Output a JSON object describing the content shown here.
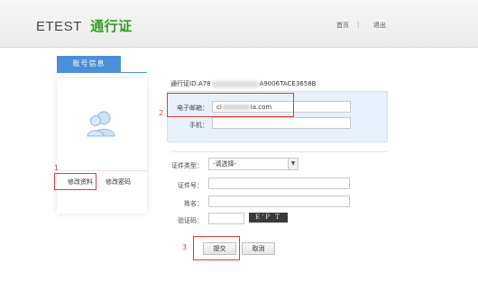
{
  "header": {
    "brand_latin": "ETEST",
    "brand_cn": "通行证",
    "nav_home": "首页",
    "nav_sep": "|",
    "nav_logout": "退出"
  },
  "left": {
    "tab_title": "账号信息",
    "avatar_icon": "user-group-icon",
    "link_edit": "修改资料",
    "link_password": "修改密码"
  },
  "form": {
    "uid_prefix": "通行证ID:A78",
    "uid_suffix": "A9006TACE3658B",
    "email_label": "电子邮箱：",
    "email_value_prefix": "ci",
    "email_value_suffix": "ia.com",
    "phone_label": "手机：",
    "phone_value": "",
    "idtype_label": "证件类型：",
    "idtype_value": "-请选择-",
    "idnum_label": "证件号：",
    "name_label": "姓名：",
    "captcha_label": "验证码：",
    "captcha_text": "E'P  T"
  },
  "buttons": {
    "submit": "提交",
    "cancel": "取消"
  },
  "annotations": {
    "n1": "1",
    "n2": "2",
    "n3": "3"
  },
  "colors": {
    "accent_blue": "#4a8fd8",
    "brand_green": "#2e9e1f",
    "highlight_red": "#e53b3b",
    "panel_bg": "#e7f0fb"
  }
}
